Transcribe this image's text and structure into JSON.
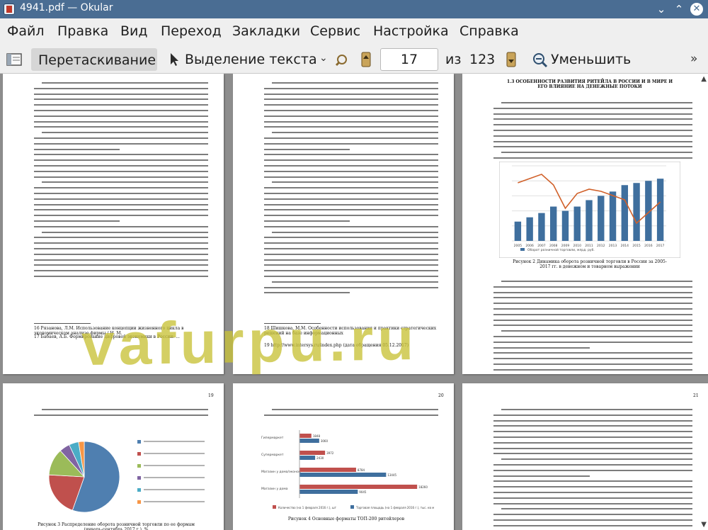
{
  "window": {
    "title": "4941.pdf — Okular",
    "buttons": {
      "shade": "⌄",
      "maximize": "⌃",
      "close": "✕"
    }
  },
  "menu": [
    "Файл",
    "Правка",
    "Вид",
    "Переход",
    "Закладки",
    "Сервис",
    "Настройка",
    "Справка"
  ],
  "toolbar": {
    "drag_label": "Перетаскивание",
    "select_label": "Выделение текста",
    "page_current": "17",
    "page_of": "из",
    "page_total": "123",
    "zoom_out_label": "Уменьшить"
  },
  "document": {
    "watermark": "vafurpu.ru",
    "pages": {
      "p1": {
        "footnotes": [
          "16 Рязанова, Л.М. Использование концепции жизненного цикла в экономическом анализе фирмы / Н. М.",
          "17 Бабаев, А.Б. Формирование цифровой экономики в России: ..."
        ]
      },
      "p2": {
        "footnotes": [
          "18 Шишкова, М.М. Особенности использования и практики стратегических решений на базе информационных",
          "19 http://www.intersys.ru/index.php (дата обращения 05.12.2017)"
        ]
      },
      "p3": {
        "heading": "1.3 ОСОБЕННОСТИ РАЗВИТИЯ РИТЕЙЛА В РОССИИ И В МИРЕ И ЕГО ВЛИЯНИЕ НА ДЕНЕЖНЫЕ ПОТОКИ",
        "caption": "Рисунок 2 Динамика оборота розничной торговли в России за 2005-2017 гг. в денежном и товарном выражении",
        "chart_data": {
          "type": "bar",
          "categories": [
            "2005",
            "2006",
            "2007",
            "2008",
            "2009",
            "2010",
            "2011",
            "2012",
            "2013",
            "2014",
            "2015",
            "2016",
            "2017"
          ],
          "series": [
            {
              "name": "Оборот розничной торговли, млрд. руб.",
              "values": [
                9,
                11,
                13,
                16,
                14,
                16,
                19,
                21,
                23,
                26,
                27,
                28,
                29
              ]
            }
          ],
          "ylim": [
            0,
            35
          ]
        }
      },
      "p4": {
        "number": "19",
        "caption": "Рисунок 3 Распределение оборота розничной торговли по ее формам (январь-сентябрь 2017 г.), %",
        "chart_data": {
          "type": "pie",
          "values": [
            55.4,
            20.5,
            12.3,
            4.8,
            4.4,
            2.6
          ]
        }
      },
      "p5": {
        "number": "20",
        "caption": "Рисунок 4 Основные форматы ТОП-200 ритейлеров",
        "chart_data": {
          "type": "bar",
          "categories": [
            "Гипермаркет",
            "Супермаркет",
            "Магазин у дома/эконом",
            "Магазин у дома"
          ],
          "series": [
            {
              "name": "Количество (на 1 февраля 2016 г.), шт",
              "values": [
                1848,
                3972,
                8784,
                18260
              ]
            },
            {
              "name": "Торговая площадь (на 1 февраля 2016 г.), тыс. кв м",
              "values": [
                3060,
                2430,
                13445,
                9045
              ]
            }
          ]
        }
      },
      "p6": {
        "number": "21"
      }
    }
  },
  "colors": {
    "titlebar": "#4a6d93",
    "bar": "#3f6f9e",
    "line": "#d1612a",
    "watermark": "#c9c238"
  }
}
